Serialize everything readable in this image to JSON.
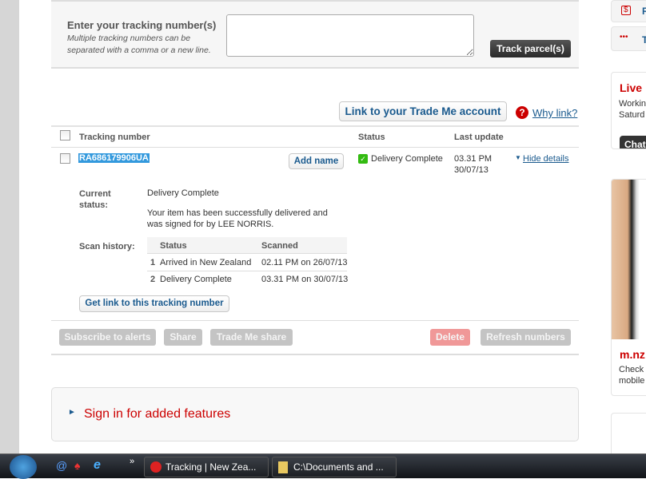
{
  "track_form": {
    "title": "Enter your tracking number(s)",
    "hint": "Multiple tracking numbers can be separated with a comma or a new line.",
    "input_value": "",
    "button": "Track parcel(s)"
  },
  "link_account": {
    "button": "Link to your Trade Me account",
    "why": "Why link?"
  },
  "table": {
    "headers": {
      "tracking": "Tracking number",
      "status": "Status",
      "last_update": "Last update"
    },
    "rows": [
      {
        "number": "RA686179906UA",
        "add_name": "Add name",
        "status": "Delivery Complete",
        "time": "03.31 PM",
        "date": "30/07/13",
        "toggle": "Hide details"
      }
    ]
  },
  "details": {
    "current_status_label": "Current status:",
    "current_status": "Delivery Complete",
    "message": "Your item has been successfully delivered and was signed for by LEE NORRIS.",
    "scan_label": "Scan history:",
    "scan_headers": {
      "status": "Status",
      "scanned": "Scanned"
    },
    "scans": [
      {
        "n": "1",
        "status": "Arrived in New Zealand",
        "scanned": "02.11 PM on 26/07/13"
      },
      {
        "n": "2",
        "status": "Delivery Complete",
        "scanned": "03.31 PM on 30/07/13"
      }
    ],
    "get_link": "Get link to this tracking number"
  },
  "actions": {
    "subscribe": "Subscribe to alerts",
    "share": "Share",
    "trademe_share": "Trade Me share",
    "delete": "Delete",
    "refresh": "Refresh numbers"
  },
  "signin": {
    "label": "Sign in for added features"
  },
  "sidebar": {
    "item1": "R",
    "item2": "T",
    "live_title": "Live",
    "live_text1": "Workin",
    "live_text2": "Saturd",
    "chat": "Chat",
    "mobile_title": "m.nz",
    "mobile_text1": "Check",
    "mobile_text2": "mobile"
  },
  "taskbar": {
    "task1": "Tracking | New Zea...",
    "task2": "C:\\Documents and ..."
  },
  "colors": {
    "accent_red": "#cc0000",
    "link_blue": "#1a5a8e",
    "selection": "#3399dd"
  }
}
